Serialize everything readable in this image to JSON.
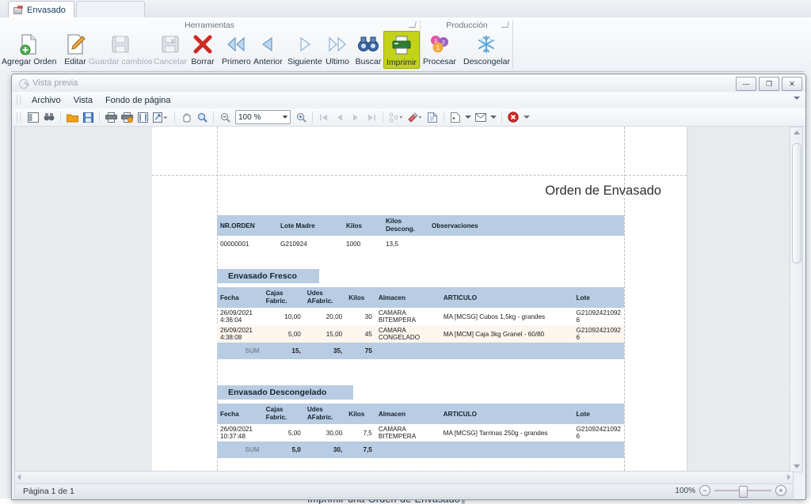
{
  "app": {
    "tab": {
      "label": "Envasado",
      "icon": "printer-icon"
    },
    "groups": [
      {
        "name": "Herramientas",
        "title": "Herramientas"
      },
      {
        "name": "Produccion",
        "title": "Producción"
      }
    ],
    "tools": [
      {
        "label": "Agregar Orden",
        "icon": "add-document-icon",
        "disabled": false,
        "highlight": false
      },
      {
        "label": "Editar",
        "icon": "edit-pencil-icon",
        "disabled": false,
        "highlight": false
      },
      {
        "label": "Guardar cambios",
        "icon": "save-disk-icon",
        "disabled": true,
        "highlight": false
      },
      {
        "label": "Cancelar",
        "icon": "cancel-disk-icon",
        "disabled": true,
        "highlight": false
      },
      {
        "label": "Borrar",
        "icon": "delete-x-icon",
        "disabled": false,
        "highlight": false
      },
      {
        "label": "Primero",
        "icon": "first-record-icon",
        "disabled": false,
        "highlight": false
      },
      {
        "label": "Anterior",
        "icon": "previous-record-icon",
        "disabled": false,
        "highlight": false
      },
      {
        "label": "Siguiente",
        "icon": "next-record-icon",
        "disabled": false,
        "highlight": false
      },
      {
        "label": "Ultimo",
        "icon": "last-record-icon",
        "disabled": false,
        "highlight": false
      },
      {
        "label": "Buscar",
        "icon": "binoculars-icon",
        "disabled": false,
        "highlight": false
      },
      {
        "label": "Imprimir",
        "icon": "print-icon",
        "disabled": false,
        "highlight": true
      }
    ],
    "production": [
      {
        "label": "Procesar",
        "icon": "balloons-icon"
      },
      {
        "label": "Descongelar",
        "icon": "snowflake-icon"
      }
    ]
  },
  "preview": {
    "title": "Vista previa",
    "title_icon": "preview-magnifier-icon",
    "window_buttons": {
      "minimize": "—",
      "maximize": "❐",
      "close": "✕"
    },
    "menu": [
      "Archivo",
      "Vista",
      "Fondo de página"
    ],
    "toolbar": {
      "zoom_value": "100 %",
      "icons": [
        "thumbnails-icon",
        "find-icon",
        "open-folder-icon",
        "save-icon",
        "print-icon",
        "quick-print-icon",
        "page-setup-icon",
        "scale-icon",
        "hand-tool-icon",
        "magnifier-icon",
        "zoom-out-icon",
        "zoom-in-icon",
        "first-page-icon",
        "previous-page-icon",
        "next-page-icon",
        "last-page-icon",
        "multiple-pages-icon",
        "page-color-icon",
        "watermark-icon",
        "export-icon",
        "email-icon",
        "close-preview-icon"
      ]
    },
    "status": {
      "page_text": "Página 1 de 1",
      "zoom_label": "100%",
      "minus": "−",
      "plus": "+"
    }
  },
  "report": {
    "title": "Orden de Envasado",
    "order_table": {
      "headers": [
        "NR.ORDEN",
        "Lote Madre",
        "Kilos",
        "Kilos Descong.",
        "Observaciones"
      ],
      "rows": [
        {
          "nr_orden": "00000001",
          "lote_madre": "G210924",
          "kilos": "1000",
          "kilos_descong": "13,5",
          "observaciones": ""
        }
      ]
    },
    "sections": [
      {
        "band": "Envasado Fresco",
        "headers": [
          "Fecha",
          "Cajas Fabric.",
          "Udes AFabric.",
          "Kilos",
          "Almacen",
          "ARTICULO",
          "Lote"
        ],
        "rows": [
          {
            "fecha_date": "26/09/2021",
            "fecha_time": "4:36:04",
            "cajas": "10,00",
            "udes": "20,00",
            "kilos": "30",
            "almacen_1": "CAMARA",
            "almacen_2": "BITEMPERA",
            "articulo": "MA [MCSG] Cubos 1,5kg - grandes",
            "lote_1": "G21092421092",
            "lote_2": "6"
          },
          {
            "fecha_date": "26/09/2021",
            "fecha_time": "4:38:08",
            "cajas": "5,00",
            "udes": "15,00",
            "kilos": "45",
            "almacen_1": "CAMARA",
            "almacen_2": "CONGELADO",
            "articulo": "MA [MCM] Caja 3kg Granel - 60/80",
            "lote_1": "G21092421092",
            "lote_2": "6"
          }
        ],
        "sum": {
          "label": "SUM",
          "cajas": "15,",
          "udes": "35,",
          "kilos": "75"
        }
      },
      {
        "band": "Envasado Descongelado",
        "headers": [
          "Fecha",
          "Cajas Fabric.",
          "Udes AFabric.",
          "Kilos",
          "Almacen",
          "ARTICULO",
          "Lote"
        ],
        "rows": [
          {
            "fecha_date": "26/09/2021",
            "fecha_time": "10:37:48",
            "cajas": "5,00",
            "udes": "30,00",
            "kilos": "7,5",
            "almacen_1": "CAMARA",
            "almacen_2": "BITEMPERA",
            "articulo": "MA [MCSG] Tarrinas 250g - grandes",
            "lote_1": "G21092421092",
            "lote_2": "6"
          }
        ],
        "sum": {
          "label": "SUM",
          "cajas": "5,0",
          "udes": "30,",
          "kilos": "7,5"
        }
      }
    ]
  },
  "background": {
    "document_line": "Imprimir·una·Orden·de·Envasado¶"
  },
  "colors": {
    "table_header": "#b8cce4",
    "highlight": "#c3d21a",
    "alt_row": "#fdf6ee",
    "page": "#ffffff"
  }
}
